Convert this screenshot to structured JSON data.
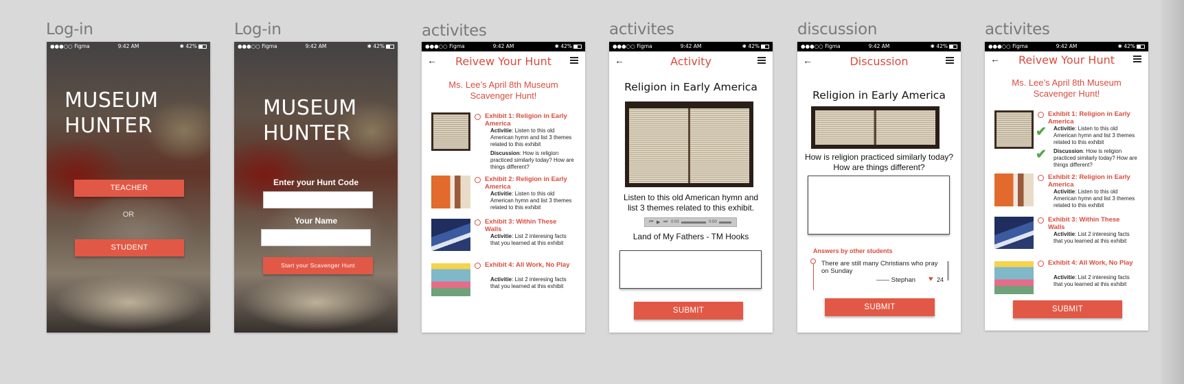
{
  "labels": {
    "f1": "Log-in",
    "f2": "Log-in",
    "f3": "activites",
    "f4": "activites",
    "f5": "discussion",
    "f6": "activites"
  },
  "status": {
    "carrier": "●●●○○ Figma",
    "time": "9:42 AM",
    "battery": "✱ 42%"
  },
  "app_title": [
    "MUSEUM",
    "HUNTER"
  ],
  "login1": {
    "teacher": "TEACHER",
    "or": "OR",
    "student": "STUDENT"
  },
  "login2": {
    "code_label": "Enter your Hunt Code",
    "name_label": "Your Name",
    "start": "Start your Scavenger Hunt"
  },
  "review": {
    "title": "Reivew Your Hunt",
    "subtitle": [
      "Ms. Lee’s April 8th Museum",
      "Scavenger Hunt!"
    ],
    "exhibits": [
      {
        "title": "Exhibit 1:  Religion in Early America",
        "activity_label": "Activitie",
        "activity": ": Listen to this old American hymn and list 3 themes related to this exhibit",
        "discussion_label": "Discussion",
        "discussion": ": How is religion practiced similarly today? How are things different?"
      },
      {
        "title": "Exhibit 2:  Religion in Early America",
        "activity_label": "Activitie",
        "activity": ": Listen to this old American hymn and list 3 themes related to this exhibit"
      },
      {
        "title": "Exhibit 3:  Within These Walls",
        "activity_label": "Activitie",
        "activity": ": List 2 interesing facts that you learned at this exhibit"
      },
      {
        "title": "Exhibit 4:  All Work, No Play",
        "activity_label": "Activitie",
        "activity": ": List 2 interesing facts that you learned at this exhibit"
      }
    ],
    "submit": "SUBMIT"
  },
  "activity": {
    "title": "Activity",
    "heading": "Religion in Early America",
    "instructions": "Listen to this old American hymn and list 3 themes related to this exhibit.",
    "song": "Land of My Fathers - TM Hooks",
    "submit": "SUBMIT",
    "audio_start": "0:00",
    "audio_end": "0:00"
  },
  "discussion": {
    "title": "Discussion",
    "heading": "Religion in Early America",
    "question": "How is religion practiced similarly today? How are things  different?",
    "answers_header": "Answers by other students",
    "answer": {
      "text": "There  are still many Christians who pray on Sunday",
      "author": "—— Stephan",
      "likes": "24"
    },
    "submit": "SUBMIT"
  },
  "colors": {
    "accent": "#e25846",
    "check": "#5aa44a"
  }
}
